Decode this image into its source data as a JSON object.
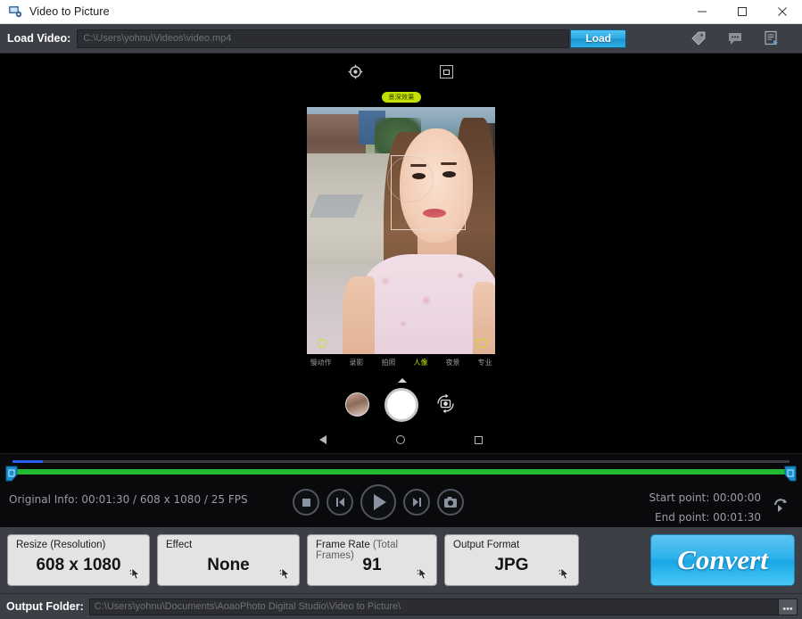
{
  "window": {
    "title": "Video to Picture",
    "icon": "app-icon",
    "minimize": "—",
    "maximize": "□",
    "close": "✕"
  },
  "load_bar": {
    "label": "Load Video:",
    "path_value": "C:\\Users\\yohnu\\Videos\\video.mp4",
    "path_placeholder": "C:\\Users\\yohnu\\Videos\\video.mp4",
    "load_button": "Load",
    "icons": [
      "tag-icon",
      "comment-icon",
      "report-icon"
    ]
  },
  "preview": {
    "effect_badge": "景深效果",
    "gear_icon": "camera-settings-icon",
    "hdr_icon": "hdr-toggle-icon",
    "camera_modes": [
      {
        "label": "慢动作",
        "active": false
      },
      {
        "label": "录影",
        "active": false
      },
      {
        "label": "拍照",
        "active": false
      },
      {
        "label": "人像",
        "active": true
      },
      {
        "label": "夜景",
        "active": false
      },
      {
        "label": "专业",
        "active": false
      }
    ],
    "shutter": "shutter-button",
    "gallery_thumb": "gallery-thumbnail",
    "flip_camera": "flip-camera-icon",
    "nav_back": "back-nav-icon",
    "nav_home": "home-nav-icon",
    "nav_recents": "recents-nav-icon"
  },
  "timeline": {
    "progress_percent": 4,
    "original_info": "Original Info: 00:01:30 / 608 x 1080 / 25 FPS",
    "start_point": "Start point: 00:00:00",
    "end_point": "End point: 00:01:30",
    "reset_icon": "reset-points-icon",
    "controls": [
      {
        "name": "stop-button",
        "glyph": "stop"
      },
      {
        "name": "previous-frame-button",
        "glyph": "prev"
      },
      {
        "name": "play-button",
        "glyph": "play"
      },
      {
        "name": "next-frame-button",
        "glyph": "next"
      },
      {
        "name": "snapshot-button",
        "glyph": "snapshot"
      }
    ]
  },
  "settings": {
    "cards": [
      {
        "title": "Resize (Resolution)",
        "title_muted": "",
        "value": "608 x 1080",
        "name": "resize-card"
      },
      {
        "title": "Effect",
        "title_muted": "",
        "value": "None",
        "name": "effect-card"
      },
      {
        "title": "Frame Rate ",
        "title_muted": "(Total Frames)",
        "value": "91",
        "name": "frame-rate-card"
      },
      {
        "title": "Output Format",
        "title_muted": "",
        "value": "JPG",
        "name": "output-format-card"
      }
    ],
    "convert_button": "Convert"
  },
  "output": {
    "label": "Output Folder:",
    "path_value": "C:\\Users\\yohnu\\Documents\\AoaoPhoto Digital Studio\\Video to Picture\\",
    "browse_button": "•••"
  },
  "colors": {
    "accent_blue": "#29a8e0",
    "panel_gray": "#3c3f45",
    "timeline_green": "#22bb33",
    "progress_blue": "#2b5ef0",
    "badge_green": "#c3e000"
  }
}
